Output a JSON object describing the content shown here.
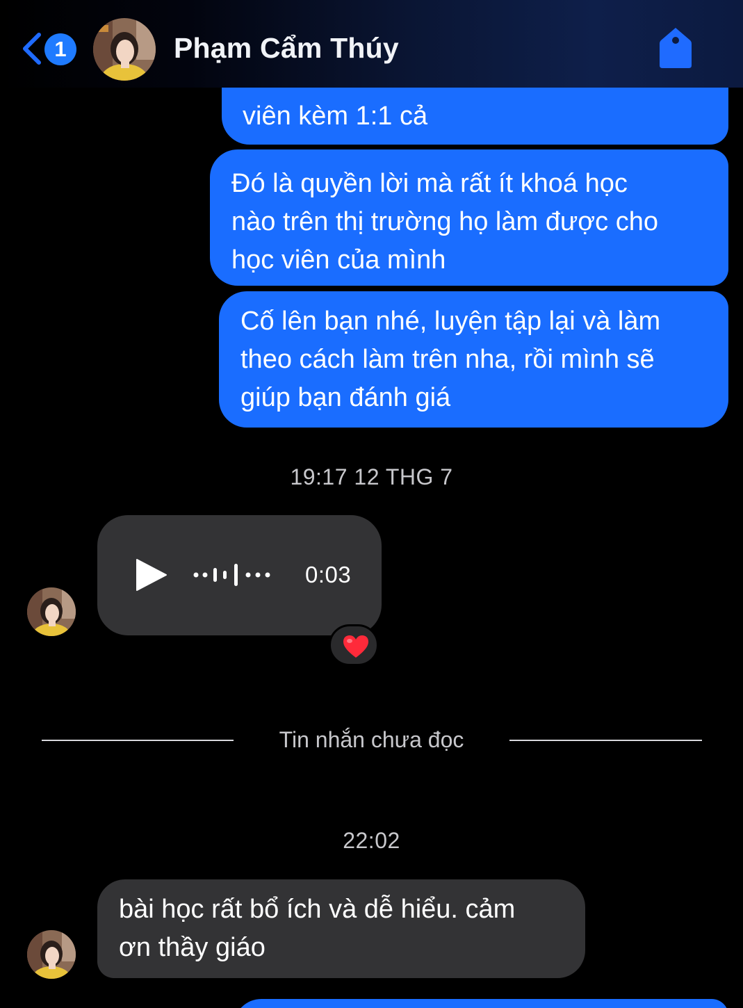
{
  "header": {
    "unread_count": "1",
    "contact_name": "Phạm Cẩm Thúy"
  },
  "messages": {
    "out_1": {
      "lines": [
        "viên kèm 1:1 cả"
      ]
    },
    "out_2": {
      "lines": [
        "Đó là quyền lời mà rất ít khoá học",
        "nào trên thị trường họ làm được cho",
        "học viên của mình"
      ]
    },
    "out_3": {
      "lines": [
        "Cố lên bạn nhé, luyện tập lại và làm",
        "theo cách làm trên nha, rồi mình sẽ",
        "giúp bạn đánh giá"
      ]
    },
    "timestamp_1": "19:17 12 THG 7",
    "voice": {
      "duration": "0:03",
      "reaction": "heart"
    },
    "unread_divider": "Tin nhắn chưa đọc",
    "timestamp_2": "22:02",
    "in_1": {
      "lines": [
        "bài học rất bổ ích và dễ hiểu. cảm",
        "ơn thầy giáo"
      ]
    }
  },
  "colors": {
    "outgoing_bubble": "#1a6dff",
    "incoming_bubble": "#333335",
    "badge": "#1f7bff",
    "accent": "#1f6bff",
    "background": "#000000"
  },
  "icons": [
    "chevron-left-icon",
    "tag-icon",
    "play-icon",
    "waveform-icon",
    "heart-icon"
  ]
}
